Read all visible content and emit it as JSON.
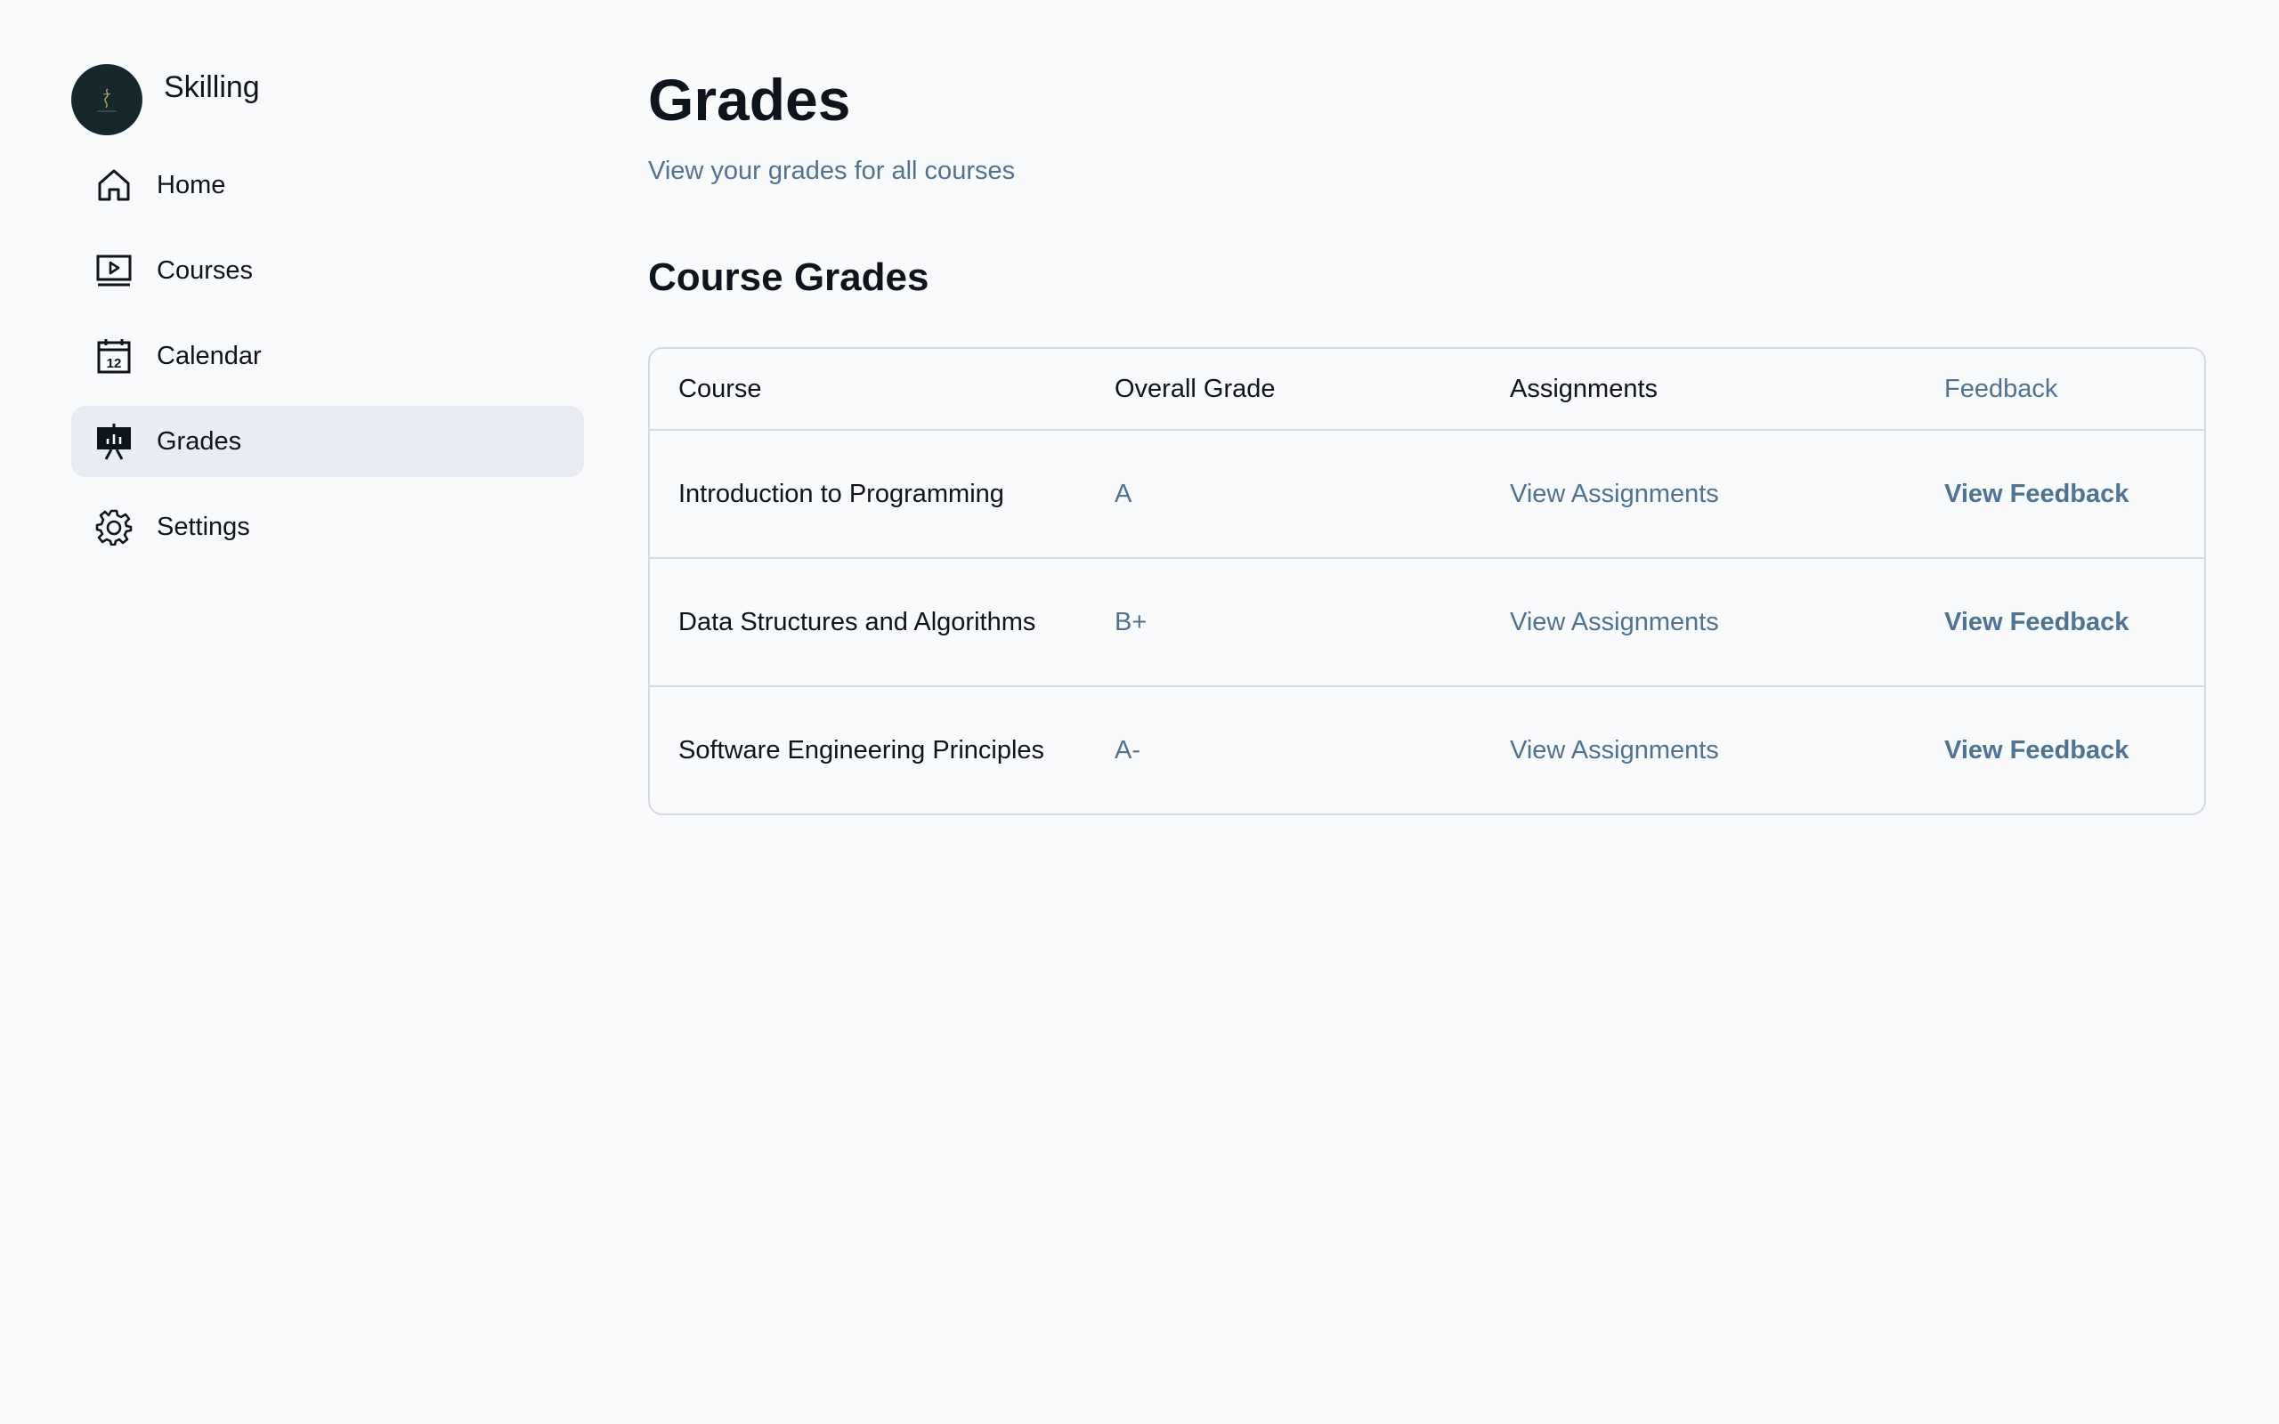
{
  "brand": {
    "name": "Skilling",
    "logo_color": "#14272b"
  },
  "sidebar": {
    "items": [
      {
        "label": "Home",
        "icon": "house-icon",
        "active": false
      },
      {
        "label": "Courses",
        "icon": "monitor-play-icon",
        "active": false
      },
      {
        "label": "Calendar",
        "icon": "calendar-icon",
        "active": false
      },
      {
        "label": "Grades",
        "icon": "presentation-chart-icon",
        "active": true
      },
      {
        "label": "Settings",
        "icon": "gear-icon",
        "active": false
      }
    ],
    "calendar_icon_day": "12"
  },
  "main": {
    "title": "Grades",
    "subtitle": "View your grades for all courses",
    "section_title": "Course Grades",
    "table": {
      "headers": {
        "course": "Course",
        "grade": "Overall Grade",
        "assignments": "Assignments",
        "feedback": "Feedback"
      },
      "rows": [
        {
          "course": "Introduction to Programming",
          "grade": "A",
          "assignments": "View Assignments",
          "feedback": "View Feedback"
        },
        {
          "course": "Data Structures and Algorithms",
          "grade": "B+",
          "assignments": "View Assignments",
          "feedback": "View Feedback"
        },
        {
          "course": "Software Engineering Principles",
          "grade": "A-",
          "assignments": "View Assignments",
          "feedback": "View Feedback"
        }
      ]
    }
  },
  "colors": {
    "background": "#f8fafc",
    "text_primary": "#0e141b",
    "text_secondary": "#4e7397",
    "border": "#d0dbe7",
    "active_nav": "#e8edf3"
  }
}
